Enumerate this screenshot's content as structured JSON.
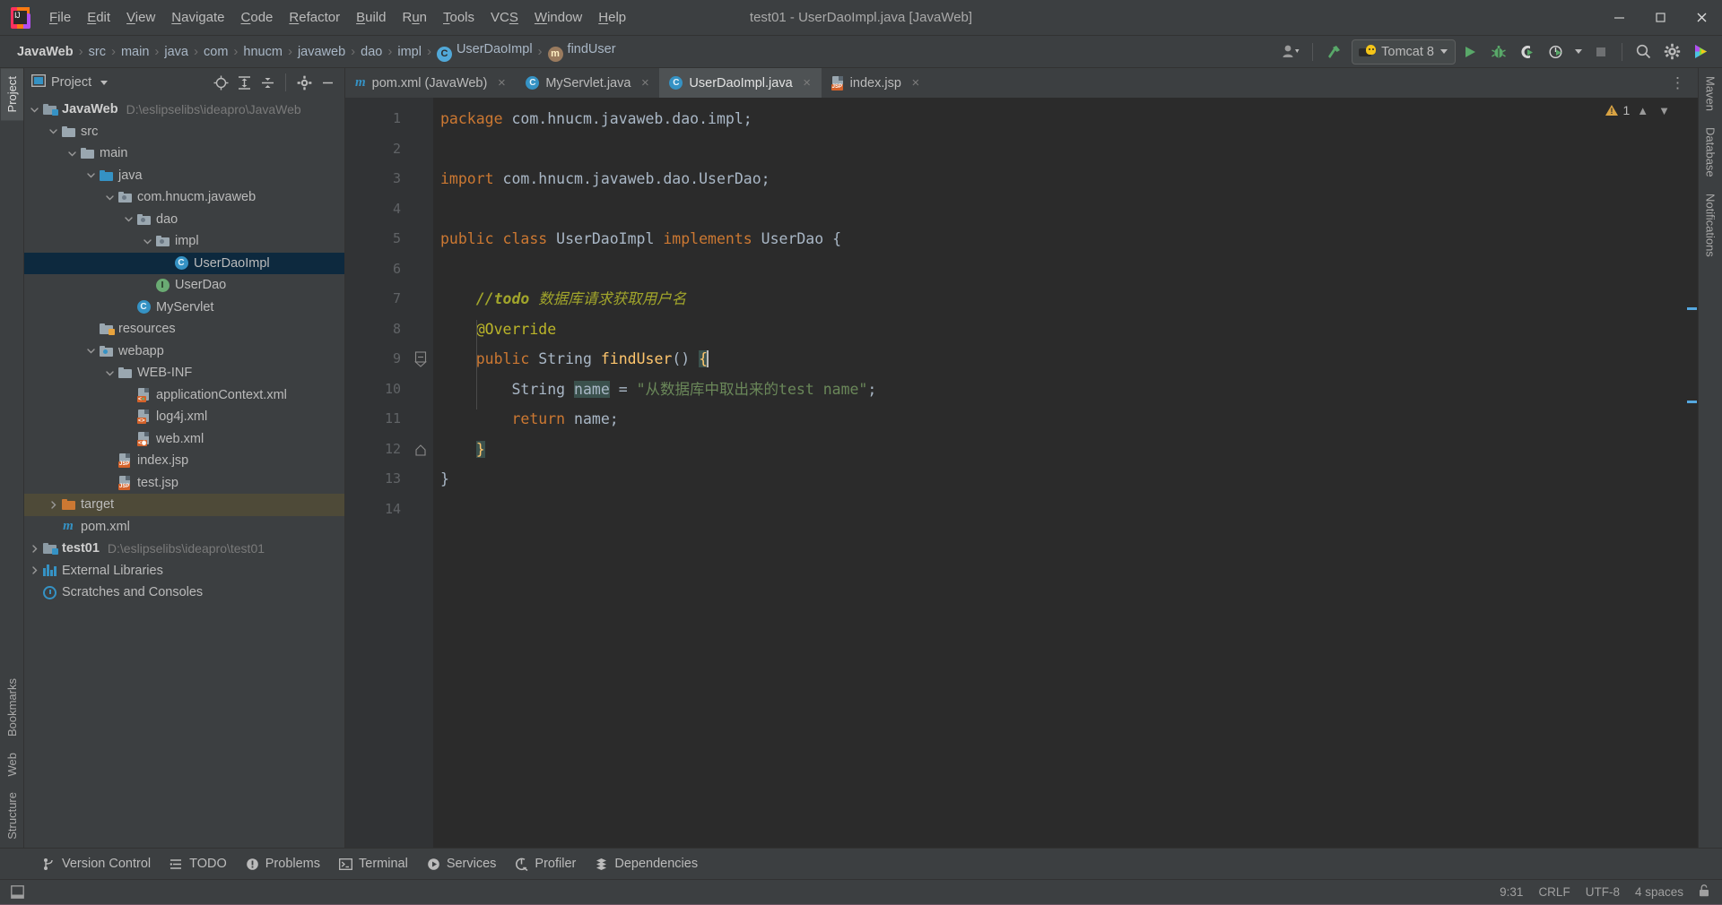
{
  "window": {
    "title": "test01 - UserDaoImpl.java [JavaWeb]",
    "app_icon": "intellij-idea-logo",
    "controls": {
      "minimize": "minimize-icon",
      "maximize": "maximize-icon",
      "close": "close-icon"
    }
  },
  "menubar": [
    {
      "label": "File",
      "mnemonic": "F"
    },
    {
      "label": "Edit",
      "mnemonic": "E"
    },
    {
      "label": "View",
      "mnemonic": "V"
    },
    {
      "label": "Navigate",
      "mnemonic": "N"
    },
    {
      "label": "Code",
      "mnemonic": "C"
    },
    {
      "label": "Refactor",
      "mnemonic": "R"
    },
    {
      "label": "Build",
      "mnemonic": "B"
    },
    {
      "label": "Run",
      "mnemonic": "u"
    },
    {
      "label": "Tools",
      "mnemonic": "T"
    },
    {
      "label": "VCS",
      "mnemonic": "S"
    },
    {
      "label": "Window",
      "mnemonic": "W"
    },
    {
      "label": "Help",
      "mnemonic": "H"
    }
  ],
  "navbar": {
    "breadcrumb": [
      {
        "label": "JavaWeb",
        "icon": null,
        "bold": true
      },
      {
        "label": "src",
        "icon": null,
        "bold": false
      },
      {
        "label": "main",
        "icon": null,
        "bold": false
      },
      {
        "label": "java",
        "icon": null,
        "bold": false
      },
      {
        "label": "com",
        "icon": null,
        "bold": false
      },
      {
        "label": "hnucm",
        "icon": null,
        "bold": false
      },
      {
        "label": "javaweb",
        "icon": null,
        "bold": false
      },
      {
        "label": "dao",
        "icon": null,
        "bold": false
      },
      {
        "label": "impl",
        "icon": null,
        "bold": false
      },
      {
        "label": "UserDaoImpl",
        "icon": "class-icon",
        "bold": false
      },
      {
        "label": "findUser",
        "icon": "method-icon",
        "bold": false
      }
    ],
    "separator": "›",
    "run_config": {
      "label": "Tomcat 8",
      "icon": "tomcat-cat-icon"
    },
    "buttons": [
      "user-account-icon",
      "build-hammer-icon",
      "run-icon",
      "debug-icon",
      "run-with-coverage-icon",
      "profile-icon",
      "stop-icon",
      "search-everywhere-icon",
      "settings-gear-icon",
      "updates-icon"
    ]
  },
  "left_strip": [
    {
      "label": "Project",
      "selected": true
    },
    {
      "label": "Bookmarks",
      "selected": false
    },
    {
      "label": "Web",
      "selected": false
    },
    {
      "label": "Structure",
      "selected": false
    }
  ],
  "right_strip": [
    {
      "label": "Maven",
      "selected": false
    },
    {
      "label": "Database",
      "selected": false
    },
    {
      "label": "Notifications",
      "selected": false
    }
  ],
  "project_panel": {
    "title": "Project",
    "title_icon": "project-view-icon",
    "actions": [
      "select-opened-file-icon",
      "expand-all-icon",
      "collapse-all-icon",
      "settings-gear-icon",
      "hide-icon"
    ],
    "tree": [
      {
        "depth": 0,
        "label": "JavaWeb",
        "path": "D:\\eslipselibs\\ideapro\\JavaWeb",
        "icon": "module-folder-icon",
        "arrow": "down",
        "bold": true,
        "state": ""
      },
      {
        "depth": 1,
        "label": "src",
        "path": "",
        "icon": "folder-icon",
        "arrow": "down",
        "bold": false,
        "state": ""
      },
      {
        "depth": 2,
        "label": "main",
        "path": "",
        "icon": "folder-icon",
        "arrow": "down",
        "bold": false,
        "state": ""
      },
      {
        "depth": 3,
        "label": "java",
        "path": "",
        "icon": "source-folder-icon",
        "arrow": "down",
        "bold": false,
        "state": ""
      },
      {
        "depth": 4,
        "label": "com.hnucm.javaweb",
        "path": "",
        "icon": "package-icon",
        "arrow": "down",
        "bold": false,
        "state": ""
      },
      {
        "depth": 5,
        "label": "dao",
        "path": "",
        "icon": "package-icon",
        "arrow": "down",
        "bold": false,
        "state": ""
      },
      {
        "depth": 6,
        "label": "impl",
        "path": "",
        "icon": "package-icon",
        "arrow": "down",
        "bold": false,
        "state": ""
      },
      {
        "depth": 7,
        "label": "UserDaoImpl",
        "path": "",
        "icon": "class-icon",
        "arrow": "none",
        "bold": false,
        "state": "selected"
      },
      {
        "depth": 6,
        "label": "UserDao",
        "path": "",
        "icon": "interface-icon",
        "arrow": "none",
        "bold": false,
        "state": ""
      },
      {
        "depth": 5,
        "label": "MyServlet",
        "path": "",
        "icon": "class-icon",
        "arrow": "none",
        "bold": false,
        "state": ""
      },
      {
        "depth": 3,
        "label": "resources",
        "path": "",
        "icon": "resources-folder-icon",
        "arrow": "none",
        "bold": false,
        "state": ""
      },
      {
        "depth": 3,
        "label": "webapp",
        "path": "",
        "icon": "webapp-folder-icon",
        "arrow": "down",
        "bold": false,
        "state": ""
      },
      {
        "depth": 4,
        "label": "WEB-INF",
        "path": "",
        "icon": "folder-icon",
        "arrow": "down",
        "bold": false,
        "state": ""
      },
      {
        "depth": 5,
        "label": "applicationContext.xml",
        "path": "",
        "icon": "spring-xml-icon",
        "arrow": "none",
        "bold": false,
        "state": ""
      },
      {
        "depth": 5,
        "label": "log4j.xml",
        "path": "",
        "icon": "xml-file-icon",
        "arrow": "none",
        "bold": false,
        "state": ""
      },
      {
        "depth": 5,
        "label": "web.xml",
        "path": "",
        "icon": "web-xml-icon",
        "arrow": "none",
        "bold": false,
        "state": ""
      },
      {
        "depth": 4,
        "label": "index.jsp",
        "path": "",
        "icon": "jsp-file-icon",
        "arrow": "none",
        "bold": false,
        "state": ""
      },
      {
        "depth": 4,
        "label": "test.jsp",
        "path": "",
        "icon": "jsp-file-icon",
        "arrow": "none",
        "bold": false,
        "state": ""
      },
      {
        "depth": 1,
        "label": "target",
        "path": "",
        "icon": "excluded-folder-icon",
        "arrow": "right",
        "bold": false,
        "state": "highlight"
      },
      {
        "depth": 1,
        "label": "pom.xml",
        "path": "",
        "icon": "maven-icon",
        "arrow": "none",
        "bold": false,
        "state": ""
      },
      {
        "depth": 0,
        "label": "test01",
        "path": "D:\\eslipselibs\\ideapro\\test01",
        "icon": "module-folder-icon",
        "arrow": "right",
        "bold": true,
        "state": ""
      },
      {
        "depth": 0,
        "label": "External Libraries",
        "path": "",
        "icon": "libraries-icon",
        "arrow": "right",
        "bold": false,
        "state": ""
      },
      {
        "depth": 0,
        "label": "Scratches and Consoles",
        "path": "",
        "icon": "scratches-icon",
        "arrow": "none",
        "bold": false,
        "state": ""
      }
    ]
  },
  "editor": {
    "tabs": [
      {
        "label": "pom.xml (JavaWeb)",
        "icon": "maven-icon",
        "active": false,
        "closable": true
      },
      {
        "label": "MyServlet.java",
        "icon": "class-icon",
        "active": false,
        "closable": true
      },
      {
        "label": "UserDaoImpl.java",
        "icon": "class-icon",
        "active": true,
        "closable": true
      },
      {
        "label": "index.jsp",
        "icon": "jsp-file-icon",
        "active": false,
        "closable": true
      }
    ],
    "tab_overflow_icon": "more-options-icon",
    "inspection": {
      "warning_count": "1",
      "warning_icon": "warning-triangle-icon",
      "up_icon": "chevron-up-icon",
      "down_icon": "chevron-down-icon"
    },
    "line_numbers": [
      "1",
      "2",
      "3",
      "4",
      "5",
      "6",
      "7",
      "8",
      "9",
      "10",
      "11",
      "12",
      "13",
      "14"
    ],
    "code_lines": [
      {
        "n": 1,
        "tokens": [
          {
            "t": "package ",
            "c": "kw"
          },
          {
            "t": "com.hnucm.javaweb.dao.impl;",
            "c": "typ"
          }
        ]
      },
      {
        "n": 2,
        "tokens": []
      },
      {
        "n": 3,
        "tokens": [
          {
            "t": "import ",
            "c": "kw"
          },
          {
            "t": "com.hnucm.javaweb.dao.UserDao;",
            "c": "typ"
          }
        ]
      },
      {
        "n": 4,
        "tokens": []
      },
      {
        "n": 5,
        "tokens": [
          {
            "t": "public class ",
            "c": "kw"
          },
          {
            "t": "UserDaoImpl ",
            "c": "typ"
          },
          {
            "t": "implements ",
            "c": "kw"
          },
          {
            "t": "UserDao {",
            "c": "typ"
          }
        ]
      },
      {
        "n": 6,
        "tokens": []
      },
      {
        "n": 7,
        "tokens": [
          {
            "t": "    ",
            "c": "typ"
          },
          {
            "t": "//todo",
            "c": "todo"
          },
          {
            "t": " 数据库请求获取用户名",
            "c": "todotxt"
          }
        ]
      },
      {
        "n": 8,
        "tokens": [
          {
            "t": "    ",
            "c": "typ"
          },
          {
            "t": "@Override",
            "c": "ann"
          }
        ]
      },
      {
        "n": 9,
        "tokens": [
          {
            "t": "    ",
            "c": "typ"
          },
          {
            "t": "public ",
            "c": "kw"
          },
          {
            "t": "String ",
            "c": "typ"
          },
          {
            "t": "findUser",
            "c": "mthname"
          },
          {
            "t": "() ",
            "c": "typ"
          },
          {
            "t": "{",
            "c": "brace"
          }
        ]
      },
      {
        "n": 10,
        "tokens": [
          {
            "t": "        ",
            "c": "typ"
          },
          {
            "t": "String ",
            "c": "typ"
          },
          {
            "t": "name",
            "c": "ident-hl"
          },
          {
            "t": " = ",
            "c": "typ"
          },
          {
            "t": "\"从数据库中取出来的test name\"",
            "c": "str"
          },
          {
            "t": ";",
            "c": "typ"
          }
        ]
      },
      {
        "n": 11,
        "tokens": [
          {
            "t": "        ",
            "c": "typ"
          },
          {
            "t": "return ",
            "c": "kw"
          },
          {
            "t": "name;",
            "c": "typ"
          }
        ]
      },
      {
        "n": 12,
        "tokens": [
          {
            "t": "    ",
            "c": "typ"
          },
          {
            "t": "}",
            "c": "brace"
          }
        ]
      },
      {
        "n": 13,
        "tokens": [
          {
            "t": "}",
            "c": "typ"
          }
        ]
      },
      {
        "n": 14,
        "tokens": []
      }
    ],
    "gutter_markers": [
      {
        "line": 9,
        "icon": "implementing-method-icon"
      }
    ],
    "fold_markers": [
      {
        "line": 9,
        "icon": "fold-expanded-icon"
      },
      {
        "line": 12,
        "icon": "fold-end-icon"
      }
    ]
  },
  "bottom_bar": [
    {
      "label": "Version Control",
      "icon": "branch-icon"
    },
    {
      "label": "TODO",
      "icon": "todo-list-icon"
    },
    {
      "label": "Problems",
      "icon": "problems-icon"
    },
    {
      "label": "Terminal",
      "icon": "terminal-icon"
    },
    {
      "label": "Services",
      "icon": "services-icon"
    },
    {
      "label": "Profiler",
      "icon": "profiler-icon"
    },
    {
      "label": "Dependencies",
      "icon": "dependencies-icon"
    }
  ],
  "status_bar": {
    "left_icon": "toggle-toolwindows-icon",
    "caret_position": "9:31",
    "line_separator": "CRLF",
    "encoding": "UTF-8",
    "indent": "4 spaces",
    "lock_icon": "unlock-icon"
  },
  "colors": {
    "background": "#3C3F41",
    "editor_background": "#2B2B2B",
    "gutter_background": "#313335",
    "selection": "#0D293E",
    "keyword": "#CC7832",
    "string": "#6A8759",
    "annotation": "#BBB529",
    "todo": "#A1A52B",
    "method": "#FFC66D",
    "identifier": "#A9B7C6",
    "accent_blue": "#3592C4",
    "green_run": "#59A869"
  }
}
